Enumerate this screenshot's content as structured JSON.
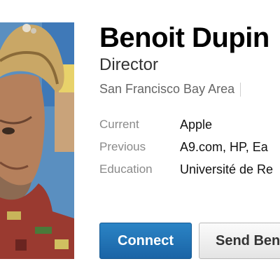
{
  "profile": {
    "name": "Benoit Dupin",
    "headline": "Director",
    "location": "San Francisco Bay Area",
    "details": [
      {
        "label": "Current",
        "value": "Apple"
      },
      {
        "label": "Previous",
        "value": "A9.com, HP, Ea"
      },
      {
        "label": "Education",
        "value": "Université de Re"
      }
    ]
  },
  "actions": {
    "connect_label": "Connect",
    "send_label": "Send Ben"
  },
  "colors": {
    "connect_button": "#1f6fb2",
    "label_gray": "#8a8a8a"
  }
}
